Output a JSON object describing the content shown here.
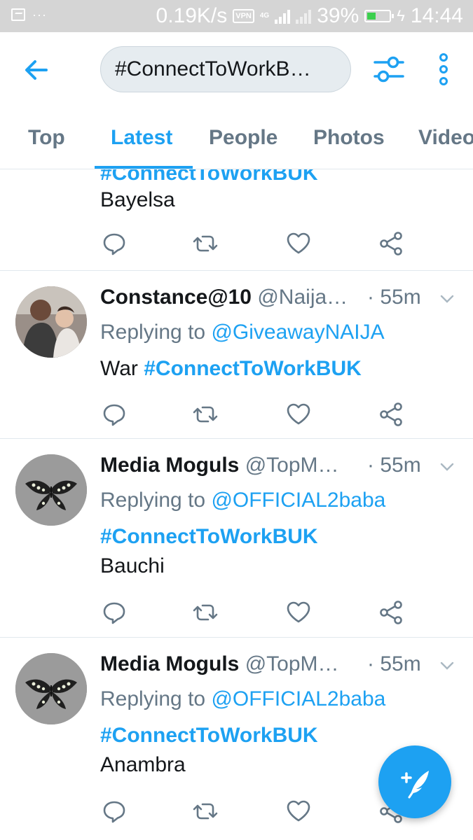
{
  "status_bar": {
    "speed": "0.19K/s",
    "vpn": "VPN",
    "network": "4G",
    "battery_percent": "39%",
    "battery_level": 0.39,
    "time": "14:44",
    "dots": "···"
  },
  "header": {
    "search_value": "#ConnectToWorkB…",
    "icons": [
      "back-arrow-icon",
      "filter-icon",
      "more-vertical-icon"
    ]
  },
  "tabs": [
    {
      "label": "Top",
      "active": false
    },
    {
      "label": "Latest",
      "active": true
    },
    {
      "label": "People",
      "active": false
    },
    {
      "label": "Photos",
      "active": false
    },
    {
      "label": "Videos",
      "active": false
    }
  ],
  "feed": {
    "partial_tweet": {
      "hashtag": "#ConnectToWorkBUK",
      "text": "Bayelsa"
    },
    "tweets": [
      {
        "name": "Constance@10",
        "handle": "@Naija…",
        "time": "· 55m",
        "replying_label": "Replying to ",
        "replying_to": "@GiveawayNAIJA",
        "text_prefix": "War ",
        "hashtag": "#ConnectToWorkBUK",
        "text": ""
      },
      {
        "name": "Media Moguls",
        "handle": "@TopM…",
        "time": "· 55m",
        "replying_label": "Replying to ",
        "replying_to": "@OFFICIAL2baba",
        "hashtag": "#ConnectToWorkBUK",
        "text": "Bauchi"
      },
      {
        "name": "Media Moguls",
        "handle": "@TopM…",
        "time": "· 55m",
        "replying_label": "Replying to ",
        "replying_to": "@OFFICIAL2baba",
        "hashtag": "#ConnectToWorkBUK",
        "text": "Anambra"
      }
    ]
  },
  "colors": {
    "accent": "#1da1f2",
    "secondary_text": "#657786",
    "divider": "#e1e8ed",
    "status_bar": "#d5d5d5"
  }
}
